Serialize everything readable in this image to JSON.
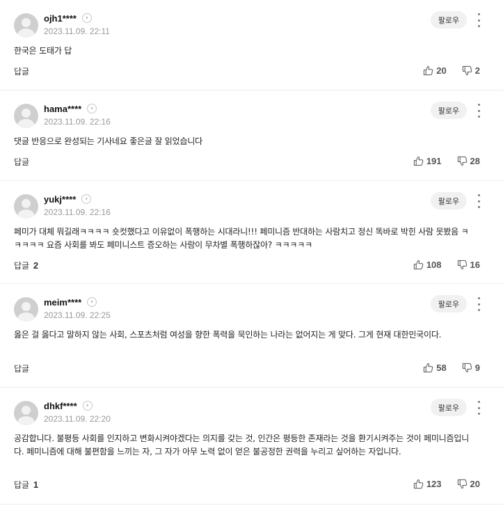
{
  "comments": [
    {
      "name": "ojh1****",
      "date": "2023.11.09. 22:11",
      "text": "한국은 도태가 답",
      "follow": "팔로우",
      "reply": "답글",
      "reply_count": "",
      "likes": "20",
      "dislikes": "2"
    },
    {
      "name": "hama****",
      "date": "2023.11.09. 22:16",
      "text": "댓글 반응으로 완성되는 기사네요 좋은글 잘 읽었습니다",
      "follow": "팔로우",
      "reply": "답글",
      "reply_count": "",
      "likes": "191",
      "dislikes": "28"
    },
    {
      "name": "yukj****",
      "date": "2023.11.09. 22:16",
      "text": "페미가 대체 뭐길래ㅋㅋㅋㅋ 숏컷했다고 이유없이 폭행하는 시대라니!!! 페미니즘 반대하는 사람치고 정신 똑바로 박힌 사람 못봤음 ㅋㅋㅋㅋㅋ 요즘 사회를 봐도 페미니스트 증오하는 사람이 무차별 폭행하잖아? ㅋㅋㅋㅋㅋ",
      "follow": "팔로우",
      "reply": "답글",
      "reply_count": "2",
      "likes": "108",
      "dislikes": "16"
    },
    {
      "name": "meim****",
      "date": "2023.11.09. 22:25",
      "text": "옳은 걸 옳다고 말하지 않는 사회, 스포츠처럼 여성을 향한 폭력을 묵인하는 나라는 없어지는 게 맞다. 그게 현재 대한민국이다.",
      "follow": "팔로우",
      "reply": "답글",
      "reply_count": "",
      "likes": "58",
      "dislikes": "9"
    },
    {
      "name": "dhkf****",
      "date": "2023.11.09. 22:20",
      "text": "공감합니다. 불평등 사회를 인지하고 변화시켜야겠다는 의지를 갖는 것, 인간은 평등한 존재라는 것을 환기시켜주는 것이 페미니즘입니다. 페미니즘에 대해 불편함을 느끼는 자, 그 자가 아무 노력 없이 얻은 불공정한 권력을 누리고 싶어하는 자입니다.",
      "follow": "팔로우",
      "reply": "답글",
      "reply_count": "1",
      "likes": "123",
      "dislikes": "20"
    }
  ]
}
